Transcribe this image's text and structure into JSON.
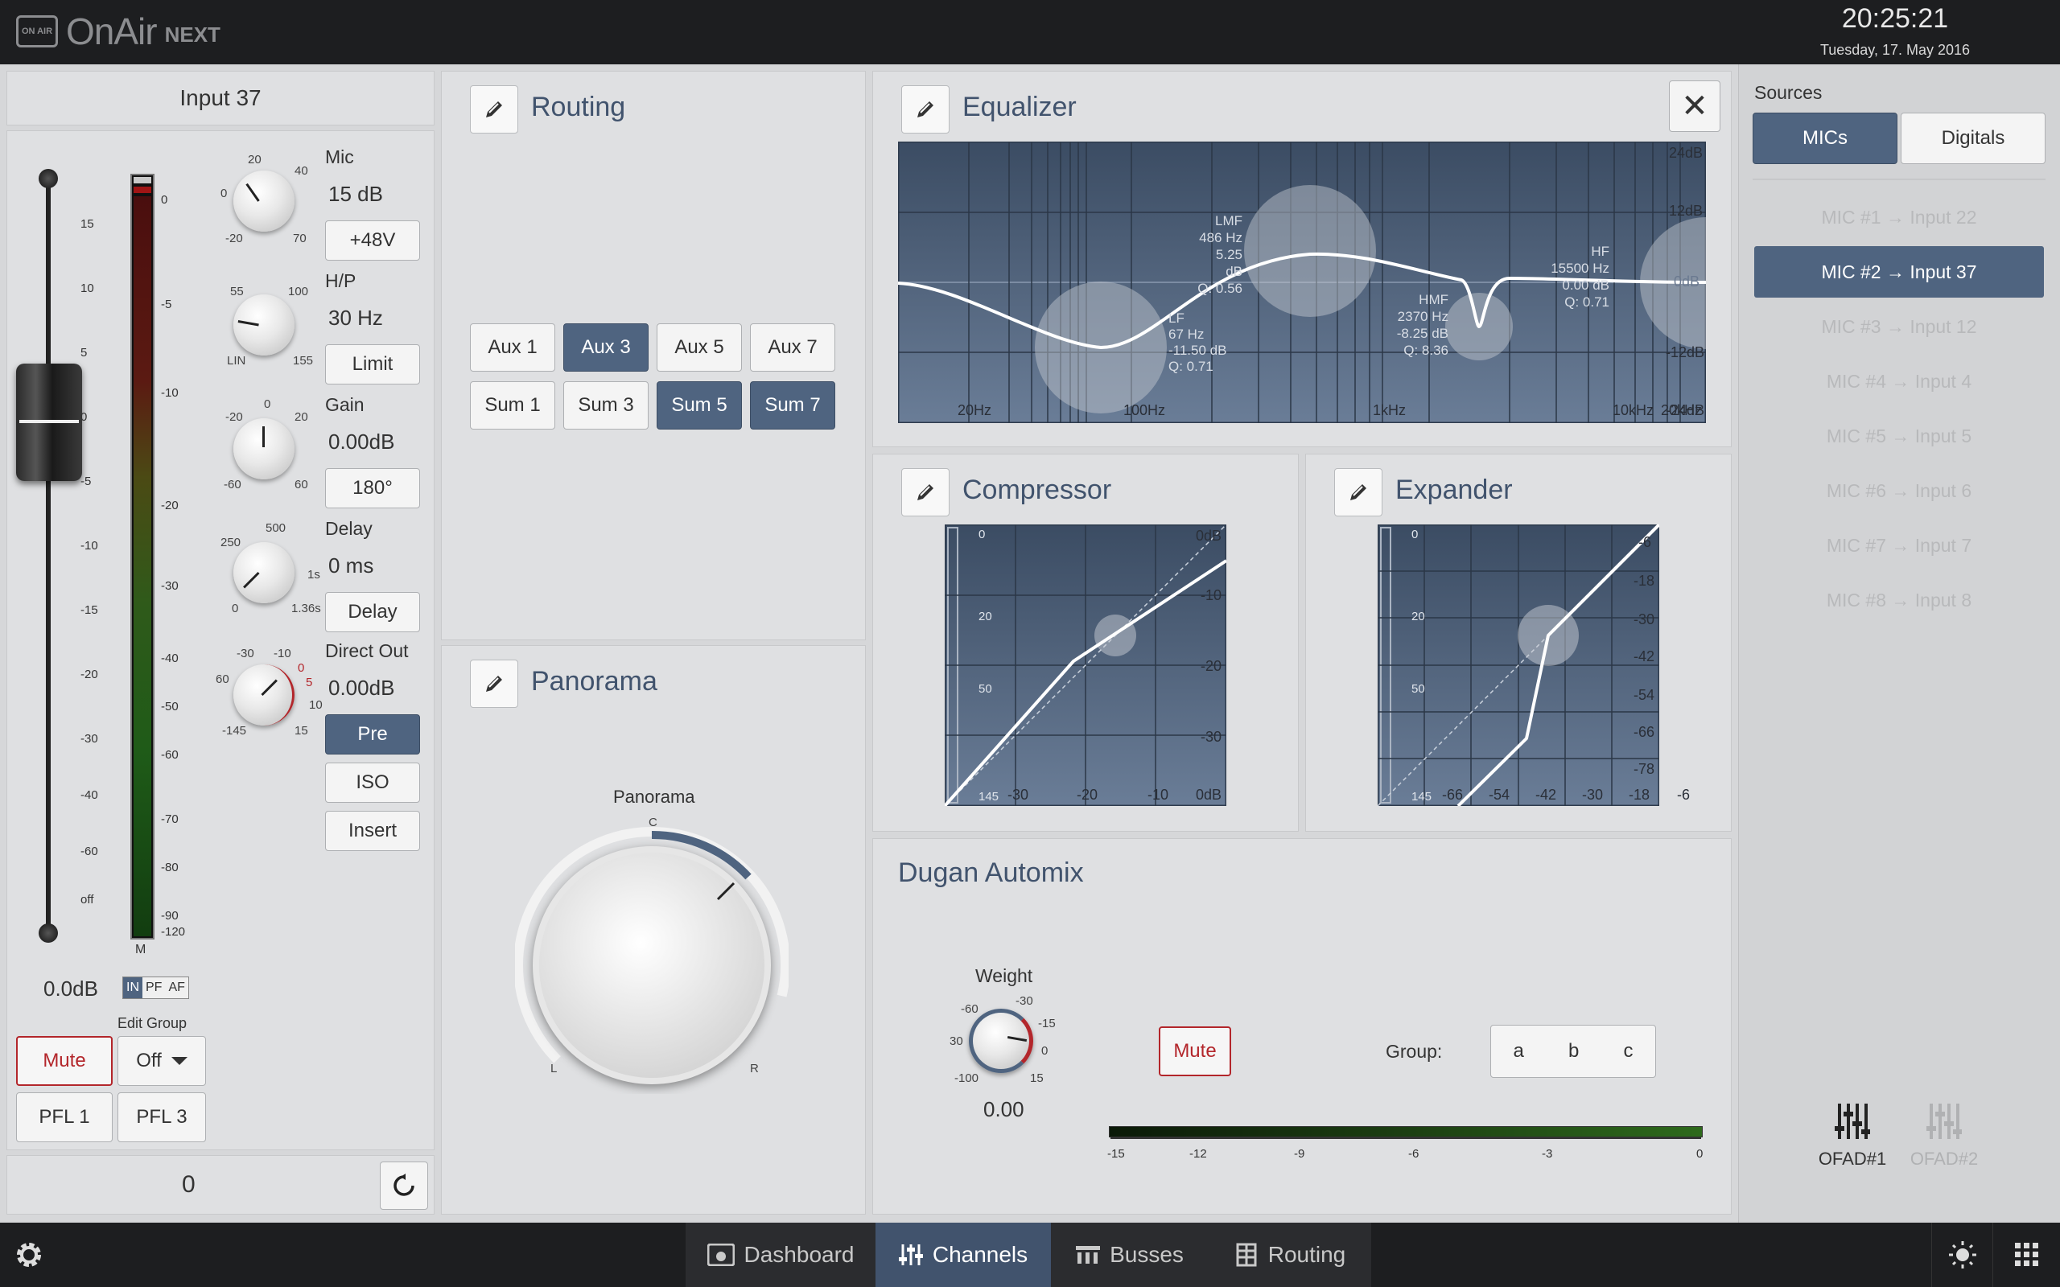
{
  "header": {
    "app_name": "OnAir",
    "app_suffix": "NEXT",
    "logo_badge": "ON AIR",
    "time": "20:25:21",
    "date": "Tuesday, 17. May 2016"
  },
  "channel": {
    "title": "Input 37",
    "fader_scale": [
      "15",
      "10",
      "5",
      "0",
      "-5",
      "-10",
      "-15",
      "-20",
      "-30",
      "-40",
      "-60",
      "off"
    ],
    "meter_scale": [
      "0",
      "-5",
      "-10",
      "-20",
      "-30",
      "-40",
      "-50",
      "-60",
      "-70",
      "-80",
      "-90",
      "-120"
    ],
    "meter_label": "M",
    "fader_value": "0.0dB",
    "meter_modes": [
      "IN",
      "PF",
      "AF"
    ],
    "mic": {
      "label": "Mic",
      "value": "15 dB",
      "button": "+48V",
      "ticks": [
        "20",
        "40",
        "0",
        "-20",
        "70"
      ]
    },
    "hp": {
      "label": "H/P",
      "value": "30 Hz",
      "button": "Limit",
      "ticks": [
        "55",
        "100",
        "LIN",
        "155"
      ]
    },
    "gain": {
      "label": "Gain",
      "value": "0.00dB",
      "button": "180°",
      "ticks": [
        "0",
        "-20",
        "20",
        "-60",
        "60"
      ]
    },
    "delay": {
      "label": "Delay",
      "value": "0 ms",
      "button": "Delay",
      "ticks": [
        "250",
        "500",
        "1s",
        "0",
        "1.36s"
      ]
    },
    "direct_out": {
      "label": "Direct Out",
      "value": "0.00dB",
      "ticks": [
        "-30",
        "-10",
        "60",
        "0",
        "5",
        "10",
        "-145",
        "15"
      ]
    },
    "buttons": {
      "pre": "Pre",
      "iso": "ISO",
      "insert": "Insert",
      "mute": "Mute",
      "pfl1": "PFL 1",
      "pfl3": "PFL 3"
    },
    "edit_group": {
      "label": "Edit Group",
      "value": "Off"
    },
    "footer_value": "0"
  },
  "routing": {
    "title": "Routing",
    "buttons": [
      {
        "label": "Aux 1",
        "on": false
      },
      {
        "label": "Aux 3",
        "on": true
      },
      {
        "label": "Aux 5",
        "on": false
      },
      {
        "label": "Aux 7",
        "on": false
      },
      {
        "label": "Sum 1",
        "on": false
      },
      {
        "label": "Sum 3",
        "on": false
      },
      {
        "label": "Sum 5",
        "on": true
      },
      {
        "label": "Sum 7",
        "on": true
      }
    ]
  },
  "panorama": {
    "title": "Panorama",
    "knob_label": "Panorama",
    "ticks": {
      "c": "C",
      "l": "L",
      "r": "R"
    }
  },
  "equalizer": {
    "title": "Equalizer",
    "y_labels": [
      "24dB",
      "12dB",
      "0dB",
      "-12dB",
      "-24dB"
    ],
    "x_labels": [
      "20Hz",
      "100Hz",
      "1kHz",
      "10kHz",
      "20kHz"
    ],
    "bands": [
      {
        "name": "LF",
        "freq": "67 Hz",
        "gain": "-11.50 dB",
        "q": "Q: 0.71"
      },
      {
        "name": "LMF",
        "freq": "486 Hz",
        "gain": "5.25 dB",
        "q": "Q: 0.56"
      },
      {
        "name": "HMF",
        "freq": "2370 Hz",
        "gain": "-8.25 dB",
        "q": "Q: 8.36"
      },
      {
        "name": "HF",
        "freq": "15500 Hz",
        "gain": "0.00 dB",
        "q": "Q: 0.71"
      }
    ]
  },
  "compressor": {
    "title": "Compressor",
    "left_scale": [
      "0",
      "20",
      "50",
      "145"
    ],
    "right_scale": [
      "0dB",
      "-10",
      "-20",
      "-30"
    ],
    "bottom_scale": [
      "-30",
      "-20",
      "-10",
      "0dB"
    ]
  },
  "expander": {
    "title": "Expander",
    "left_scale": [
      "0",
      "20",
      "50",
      "145"
    ],
    "right_scale": [
      "-6",
      "-18",
      "-30",
      "-42",
      "-54",
      "-66",
      "-78"
    ],
    "bottom_scale": [
      "-66",
      "-54",
      "-42",
      "-30",
      "-18",
      "-6"
    ]
  },
  "automix": {
    "title": "Dugan Automix",
    "weight_label": "Weight",
    "weight_value": "0.00",
    "weight_ticks": [
      "-30",
      "-60",
      "-15",
      "30",
      "0",
      "-100",
      "15"
    ],
    "mute": "Mute",
    "group_label": "Group:",
    "groups": [
      "a",
      "b",
      "c"
    ],
    "meter_scale": [
      "-15",
      "-12",
      "-9",
      "-6",
      "-3",
      "0"
    ]
  },
  "sources": {
    "title": "Sources",
    "tabs": [
      "MICs",
      "Digitals"
    ],
    "items": [
      {
        "label": "MIC #1 → Input 22",
        "active": false
      },
      {
        "label": "MIC #2 → Input 37",
        "active": true
      },
      {
        "label": "MIC #3 → Input 12",
        "active": false
      },
      {
        "label": "MIC #4 → Input 4",
        "active": false
      },
      {
        "label": "MIC #5 → Input 5",
        "active": false
      },
      {
        "label": "MIC #6 → Input 6",
        "active": false
      },
      {
        "label": "MIC #7 → Input 7",
        "active": false
      },
      {
        "label": "MIC #8 → Input 8",
        "active": false
      }
    ],
    "ofad": [
      "OFAD#1",
      "OFAD#2"
    ]
  },
  "nav": {
    "tabs": [
      "Dashboard",
      "Channels",
      "Busses",
      "Routing"
    ],
    "active": "Channels"
  }
}
